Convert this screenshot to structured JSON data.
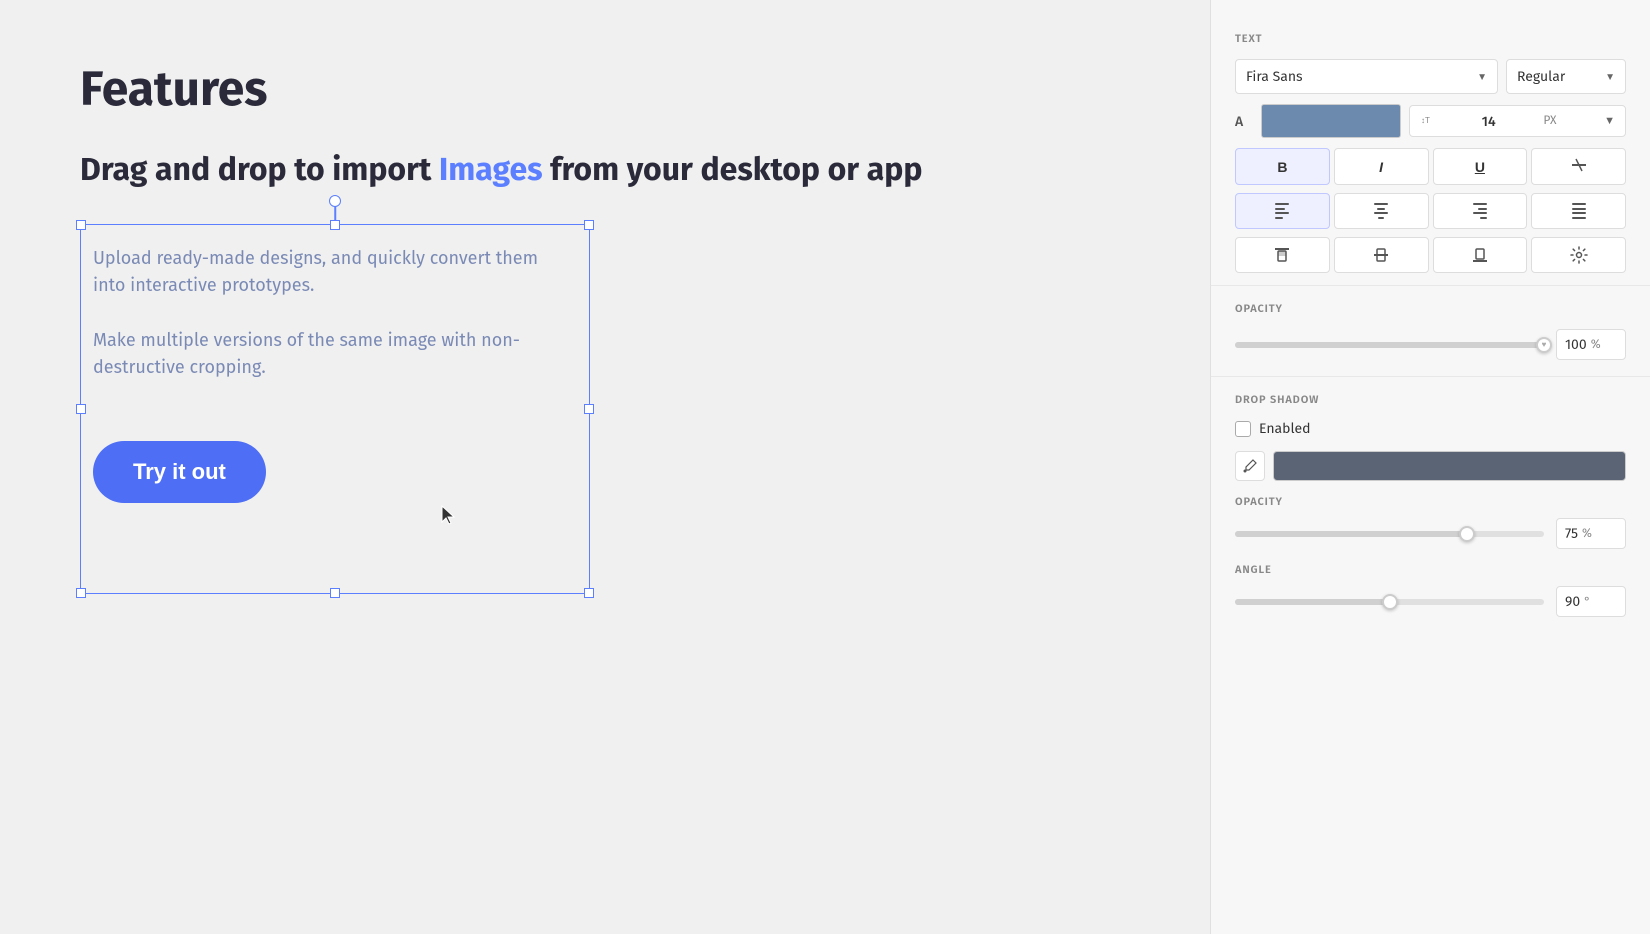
{
  "canvas": {
    "heading": "Features",
    "drag_drop_text_start": "Drag and drop to import ",
    "drag_drop_link": "Images",
    "drag_drop_text_end": " from your desktop or app",
    "upload_text": "Upload ready-made designs, and quickly convert them into interactive prototypes.",
    "make_multiple_text": "Make multiple versions of the same image with non-destructive cropping.",
    "try_button_label": "Try it out"
  },
  "right_panel": {
    "text_section_label": "TEXT",
    "font_name": "Fira Sans",
    "font_weight": "Regular",
    "color_label": "A",
    "font_size": "14",
    "font_size_unit": "PX",
    "bold_label": "B",
    "italic_label": "I",
    "underline_label": "U",
    "strikethrough_label": "S̶",
    "opacity_label": "OPACITY",
    "opacity_value": "100",
    "opacity_unit": "%",
    "drop_shadow_label": "DROP SHADOW",
    "enabled_label": "Enabled",
    "shadow_opacity_label": "OPACITY",
    "shadow_opacity_value": "75",
    "shadow_opacity_unit": "%",
    "angle_label": "ANGLE",
    "angle_value": "90",
    "angle_unit": "°"
  }
}
